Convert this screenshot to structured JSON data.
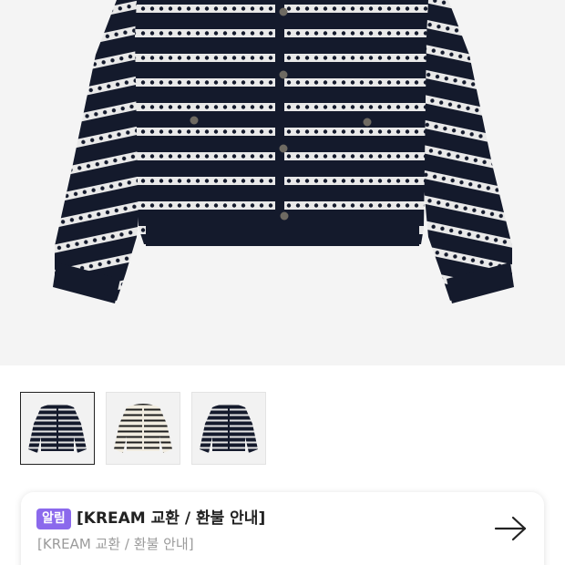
{
  "product": {
    "images": [
      {
        "alt": "navy-white-stripe-cardigan",
        "selected": true
      },
      {
        "alt": "cream-black-stripe-cardigan",
        "selected": false
      },
      {
        "alt": "navy-white-stripe-cardigan-alt",
        "selected": false
      }
    ],
    "colors": {
      "navy": "#141a2c",
      "white_stripe": "#ececec",
      "cream": "#f1ece0",
      "black": "#1c1c1c",
      "button": "#6e6a62",
      "hero_bg": "#f4f4f4"
    }
  },
  "notice": {
    "badge": "알림",
    "title": "[KREAM 교환 / 환불 안내]",
    "subtitle": "[KREAM 교환 / 환불 안내]",
    "icon": "arrow-right-icon",
    "badge_color": "#8b69ec"
  }
}
